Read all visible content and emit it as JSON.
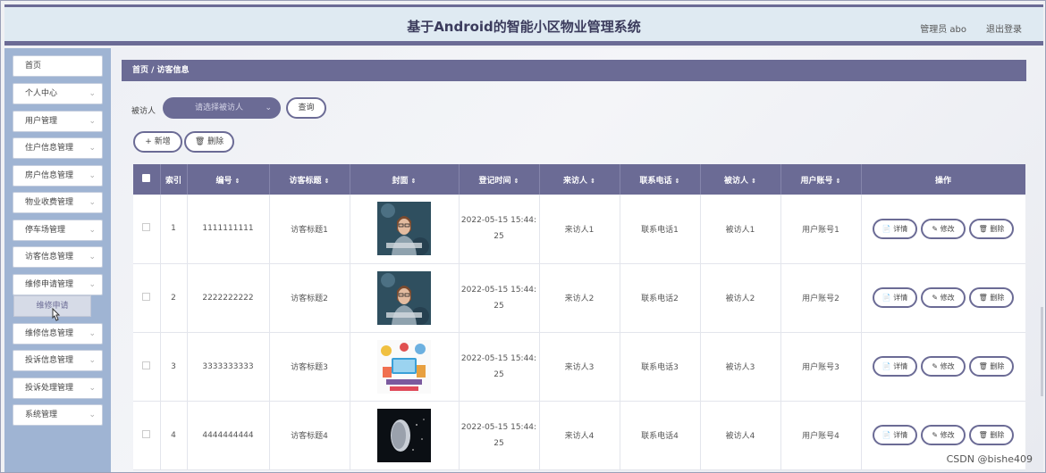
{
  "header": {
    "title": "基于Android的智能小区物业管理系统",
    "user": "管理员 abo",
    "logout": "退出登录"
  },
  "sidebar": {
    "items": [
      {
        "label": "首页",
        "has_arrow": false
      },
      {
        "label": "个人中心",
        "has_arrow": true
      },
      {
        "label": "用户管理",
        "has_arrow": true
      },
      {
        "label": "住户信息管理",
        "has_arrow": true
      },
      {
        "label": "房户信息管理",
        "has_arrow": true
      },
      {
        "label": "物业收费管理",
        "has_arrow": true
      },
      {
        "label": "停车场管理",
        "has_arrow": true
      },
      {
        "label": "访客信息管理",
        "has_arrow": true
      },
      {
        "label": "维修申请管理",
        "has_arrow": true
      },
      {
        "label": "维修信息管理",
        "has_arrow": true
      },
      {
        "label": "投诉信息管理",
        "has_arrow": true
      },
      {
        "label": "投诉处理管理",
        "has_arrow": true
      },
      {
        "label": "系统管理",
        "has_arrow": true
      }
    ],
    "submenu": "维修申请",
    "chevron": "⌄"
  },
  "breadcrumb": "首页 / 访客信息",
  "filter": {
    "label": "被访人",
    "placeholder": "请选择被访人",
    "query_button": "查询"
  },
  "actions": {
    "add": "+ 新增",
    "delete": "🗑 删除"
  },
  "table": {
    "headers": [
      "",
      "索引",
      "编号",
      "访客标题",
      "封面",
      "登记时间",
      "来访人",
      "联系电话",
      "被访人",
      "用户账号",
      "操作"
    ],
    "sort_icon": "⇕",
    "rows": [
      {
        "index": "1",
        "code": "1111111111",
        "title": "访客标题1",
        "date": "2022-05-15 15:44:",
        "time": "25",
        "visitor": "来访人1",
        "phone": "联系电话1",
        "visited": "被访人1",
        "account": "用户账号1",
        "cover": "person"
      },
      {
        "index": "2",
        "code": "2222222222",
        "title": "访客标题2",
        "date": "2022-05-15 15:44:",
        "time": "25",
        "visitor": "来访人2",
        "phone": "联系电话2",
        "visited": "被访人2",
        "account": "用户账号2",
        "cover": "person"
      },
      {
        "index": "3",
        "code": "3333333333",
        "title": "访客标题3",
        "date": "2022-05-15 15:44:",
        "time": "25",
        "visitor": "来访人3",
        "phone": "联系电话3",
        "visited": "被访人3",
        "account": "用户账号3",
        "cover": "desk"
      },
      {
        "index": "4",
        "code": "4444444444",
        "title": "访客标题4",
        "date": "2022-05-15 15:44:",
        "time": "25",
        "visitor": "来访人4",
        "phone": "联系电话4",
        "visited": "被访人4",
        "account": "用户账号4",
        "cover": "dark"
      }
    ],
    "row_actions": {
      "detail": "📄 详情",
      "edit": "✎ 修改",
      "delete": "🗑 删除"
    }
  },
  "watermark": "CSDN @bishe409",
  "colors": {
    "accent": "#6b6b95",
    "sidebar": "#9fb4d3",
    "header_bg": "#dfeaf2"
  }
}
